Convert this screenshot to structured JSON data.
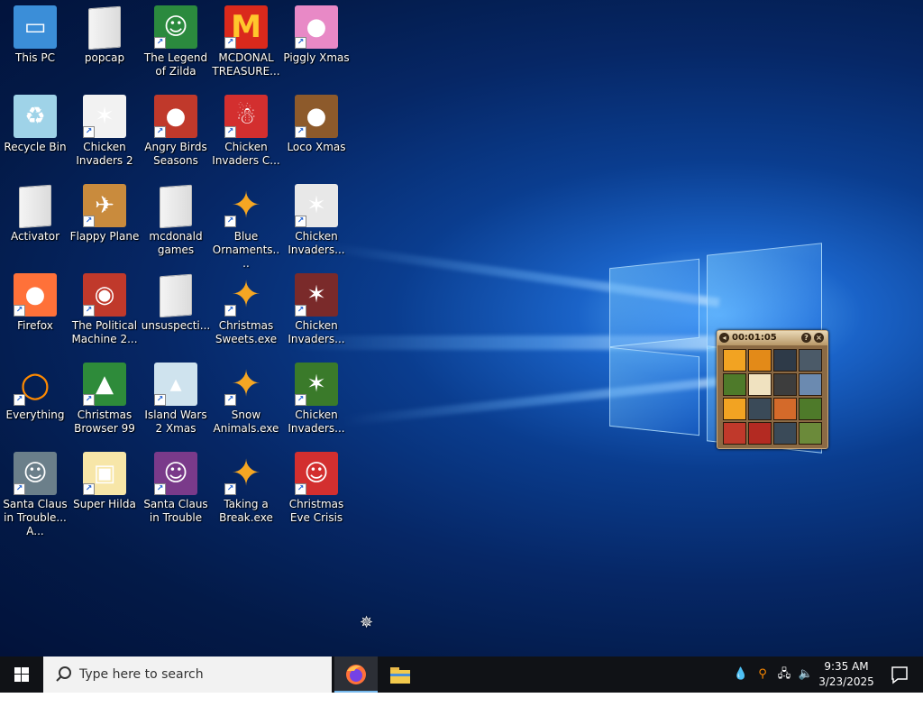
{
  "desktop_icons": [
    {
      "label": "This PC",
      "icon": "monitor-icon",
      "color": "#3b8ed8"
    },
    {
      "label": "popcap",
      "icon": "folder-icon",
      "color": "#e9e9e9"
    },
    {
      "label": "The Legend of Zilda",
      "icon": "cartoon-character-icon",
      "color": "#2b8a3e"
    },
    {
      "label": "MCDONAL TREASURE...",
      "icon": "mcdonalds-logo-icon",
      "color": "#da291c"
    },
    {
      "label": "Piggly Xmas",
      "icon": "pink-pig-icon",
      "color": "#e889c6"
    },
    {
      "label": "Recycle Bin",
      "icon": "recycle-bin-icon",
      "color": "#9fd3e8"
    },
    {
      "label": "Chicken Invaders 2",
      "icon": "chicken-icon",
      "color": "#f2f2f2"
    },
    {
      "label": "Angry Birds Seasons",
      "icon": "angry-bird-icon",
      "color": "#c0392b"
    },
    {
      "label": "Chicken Invaders C...",
      "icon": "snowman-chicken-icon",
      "color": "#d32f2f"
    },
    {
      "label": "Loco Xmas",
      "icon": "teddy-bear-icon",
      "color": "#8d5a2b"
    },
    {
      "label": "Activator",
      "icon": "file-icon",
      "color": "#e9e9e9"
    },
    {
      "label": "Flappy Plane",
      "icon": "plane-icon",
      "color": "#c98b3d"
    },
    {
      "label": "mcdonald games",
      "icon": "folder-icon",
      "color": "#e9e9e9"
    },
    {
      "label": "Blue Ornaments....",
      "icon": "exe-icon",
      "color": "#f5a623"
    },
    {
      "label": "Chicken Invaders...",
      "icon": "chicken-santa-icon",
      "color": "#e8e8e8"
    },
    {
      "label": "Firefox",
      "icon": "firefox-icon",
      "color": "#ff7139"
    },
    {
      "label": "The Political Machine 2...",
      "icon": "political-badge-icon",
      "color": "#c0392b"
    },
    {
      "label": "unsuspecti...",
      "icon": "file-icon",
      "color": "#e9e9e9"
    },
    {
      "label": "Christmas Sweets.exe",
      "icon": "exe-icon",
      "color": "#f5a623"
    },
    {
      "label": "Chicken Invaders...",
      "icon": "chicken-invaders-icon",
      "color": "#7a2a2a"
    },
    {
      "label": "Everything",
      "icon": "magnifier-icon",
      "color": "#ff8a00"
    },
    {
      "label": "Christmas Browser 99",
      "icon": "christmas-tree-icon",
      "color": "#2e8b3a"
    },
    {
      "label": "Island Wars 2 Xmas",
      "icon": "island-icon",
      "color": "#cfe3ee"
    },
    {
      "label": "Snow Animals.exe",
      "icon": "exe-icon",
      "color": "#f5a623"
    },
    {
      "label": "Chicken Invaders...",
      "icon": "chicken-invaders-icon",
      "color": "#3a7a2a"
    },
    {
      "label": "Santa Claus in Trouble... A...",
      "icon": "santa-icon",
      "color": "#6b7f8a"
    },
    {
      "label": "Super Hilda",
      "icon": "pixel-character-icon",
      "color": "#f7e6a8"
    },
    {
      "label": "Santa Claus in Trouble",
      "icon": "santa-portrait-icon",
      "color": "#7a3a8a"
    },
    {
      "label": "Taking a Break.exe",
      "icon": "exe-icon",
      "color": "#f5a623"
    },
    {
      "label": "Christmas Eve Crisis",
      "icon": "santa-face-icon",
      "color": "#d32f2f"
    }
  ],
  "puzzle_widget": {
    "timer": "00:01:05",
    "tile_colors": [
      "#f2a322",
      "#e38a18",
      "#2e3a48",
      "#4b5a68",
      "#4e7a2a",
      "#f0e2c0",
      "#3d3d3d",
      "#6b8ab0",
      "#f2a322",
      "#3a4a58",
      "#d46a2a",
      "#4e7a2a",
      "#c0392b",
      "#b32a22",
      "#3a4a58",
      "#6b8a3a"
    ]
  },
  "taskbar": {
    "search_placeholder": "Type here to search",
    "time": "9:35 AM",
    "date": "3/23/2025",
    "accent": "#76b9ed"
  }
}
